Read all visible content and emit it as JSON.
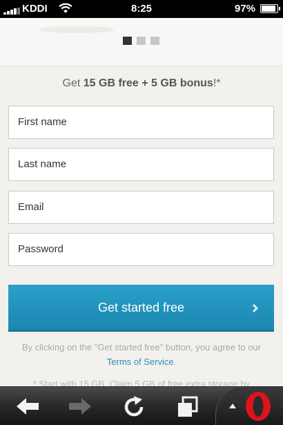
{
  "status_bar": {
    "carrier": "KDDI",
    "time": "8:25",
    "battery_percent": "97%",
    "battery_level": 0.97,
    "signal_bars": 4
  },
  "carousel": {
    "pages": 3,
    "active_page": 1
  },
  "promo": {
    "prefix": "Get ",
    "bold": "15 GB free + 5 GB bonus",
    "suffix": "!*"
  },
  "form": {
    "first_name_placeholder": "First name",
    "last_name_placeholder": "Last name",
    "email_placeholder": "Email",
    "password_placeholder": "Password",
    "submit_label": "Get started free"
  },
  "terms": {
    "text": "By clicking on the \"Get started free\" button, you agree to our ",
    "link": "Terms of Service",
    "end": "."
  },
  "footnote": "* Start with 15 GB. Claim 5 GB of free extra storage by",
  "toolbar": {
    "icons": [
      "back-arrow-icon",
      "forward-arrow-icon",
      "reload-icon",
      "tabs-icon",
      "up-arrow-icon",
      "opera-logo-icon"
    ]
  },
  "colors": {
    "accent": "#1f93bf",
    "link": "#2a8fba",
    "opera_red": "#e0121c"
  }
}
